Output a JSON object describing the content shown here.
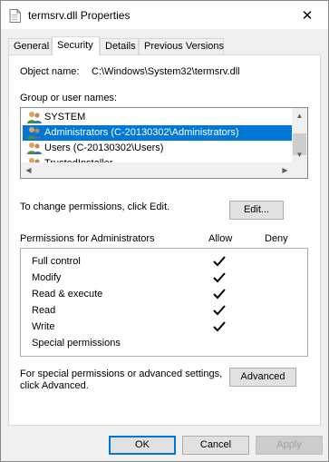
{
  "window": {
    "title": "termsrv.dll Properties",
    "close_glyph": "✕"
  },
  "tabs": [
    {
      "label": "General"
    },
    {
      "label": "Security"
    },
    {
      "label": "Details"
    },
    {
      "label": "Previous Versions"
    }
  ],
  "security": {
    "object_name_label": "Object name:",
    "object_name_value": "C:\\Windows\\System32\\termsrv.dll",
    "group_label": "Group or user names:",
    "users": [
      {
        "name": "SYSTEM"
      },
      {
        "name": "Administrators (C-20130302\\Administrators)"
      },
      {
        "name": "Users (C-20130302\\Users)"
      },
      {
        "name": "TrustedInstaller"
      }
    ],
    "change_text": "To change permissions, click Edit.",
    "edit_label": "Edit...",
    "permissions_for": "Permissions for Administrators",
    "allow_header": "Allow",
    "deny_header": "Deny",
    "permissions": [
      {
        "name": "Full control",
        "allow": true
      },
      {
        "name": "Modify",
        "allow": true
      },
      {
        "name": "Read & execute",
        "allow": true
      },
      {
        "name": "Read",
        "allow": true
      },
      {
        "name": "Write",
        "allow": true
      },
      {
        "name": "Special permissions",
        "allow": false
      }
    ],
    "special_text_1": "For special permissions or advanced settings,",
    "special_text_2": "click Advanced.",
    "advanced_label": "Advanced"
  },
  "footer": {
    "ok_label": "OK",
    "cancel_label": "Cancel",
    "apply_label": "Apply"
  },
  "colors": {
    "selection": "#0078d7",
    "dialog_bg": "#f0f0f0"
  }
}
